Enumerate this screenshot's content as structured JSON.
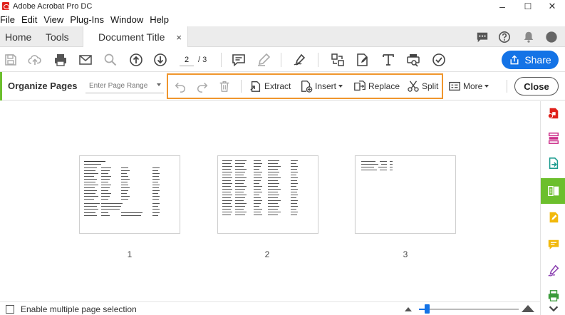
{
  "window": {
    "title": "Adobe Acrobat Pro DC",
    "minimize": "–",
    "maximize": "☐",
    "close": "✕"
  },
  "menu": [
    "File",
    "Edit",
    "View",
    "Plug-Ins",
    "Window",
    "Help"
  ],
  "tabs": {
    "home": "Home",
    "tools": "Tools",
    "document": "Document Title",
    "close_glyph": "×"
  },
  "toolbar": {
    "current_page": "2",
    "total_pages": "/ 3",
    "share_label": "Share"
  },
  "organize": {
    "title": "Organize Pages",
    "range_placeholder": "Enter Page Range",
    "extract": "Extract",
    "insert": "Insert",
    "replace": "Replace",
    "split": "Split",
    "more": "More",
    "close": "Close"
  },
  "pages": [
    {
      "number": "1"
    },
    {
      "number": "2"
    },
    {
      "number": "3"
    }
  ],
  "status": {
    "multi_select_label": "Enable multiple page selection",
    "multi_select_checked": false,
    "zoom_level": 0.08
  },
  "colors": {
    "accent_blue": "#1473e6",
    "organize_green": "#6cbf2d",
    "highlight_orange": "#f0962d",
    "acrobat_red": "#e0201a"
  }
}
